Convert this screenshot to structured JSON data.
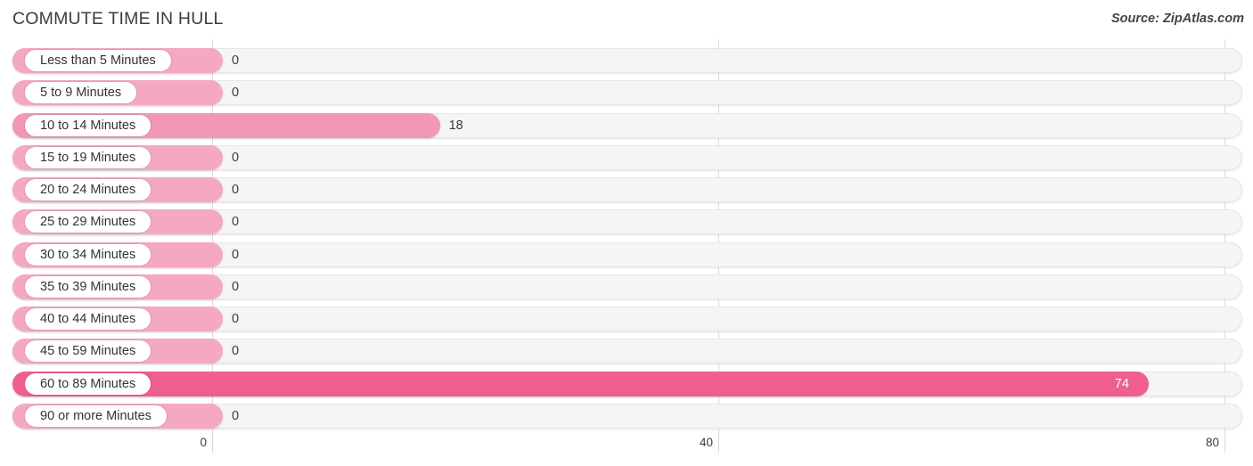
{
  "header": {
    "title": "COMMUTE TIME IN HULL",
    "source": "Source: ZipAtlas.com"
  },
  "chart_data": {
    "type": "bar",
    "orientation": "horizontal",
    "title": "COMMUTE TIME IN HULL",
    "xlabel": "",
    "ylabel": "",
    "xlim": [
      0,
      80
    ],
    "grid": true,
    "legend": "none",
    "xticks": [
      0,
      40,
      80
    ],
    "xtick_labels": [
      "0",
      "40",
      "80"
    ],
    "categories": [
      "Less than 5 Minutes",
      "5 to 9 Minutes",
      "10 to 14 Minutes",
      "15 to 19 Minutes",
      "20 to 24 Minutes",
      "25 to 29 Minutes",
      "30 to 34 Minutes",
      "35 to 39 Minutes",
      "40 to 44 Minutes",
      "45 to 59 Minutes",
      "60 to 89 Minutes",
      "90 or more Minutes"
    ],
    "values": [
      0,
      0,
      18,
      0,
      0,
      0,
      0,
      0,
      0,
      0,
      74,
      0
    ],
    "value_labels": [
      "0",
      "0",
      "18",
      "0",
      "0",
      "0",
      "0",
      "0",
      "0",
      "0",
      "74",
      "0"
    ]
  },
  "rows": [
    {
      "label": "Less than 5 Minutes",
      "value": 0,
      "value_label": "0",
      "color": "#f5a8c3",
      "label_inside": false
    },
    {
      "label": "5 to 9 Minutes",
      "value": 0,
      "value_label": "0",
      "color": "#f5a8c3",
      "label_inside": false
    },
    {
      "label": "10 to 14 Minutes",
      "value": 18,
      "value_label": "18",
      "color": "#f297b6",
      "label_inside": false
    },
    {
      "label": "15 to 19 Minutes",
      "value": 0,
      "value_label": "0",
      "color": "#f5a8c3",
      "label_inside": false
    },
    {
      "label": "20 to 24 Minutes",
      "value": 0,
      "value_label": "0",
      "color": "#f5a8c3",
      "label_inside": false
    },
    {
      "label": "25 to 29 Minutes",
      "value": 0,
      "value_label": "0",
      "color": "#f5a8c3",
      "label_inside": false
    },
    {
      "label": "30 to 34 Minutes",
      "value": 0,
      "value_label": "0",
      "color": "#f5a8c3",
      "label_inside": false
    },
    {
      "label": "35 to 39 Minutes",
      "value": 0,
      "value_label": "0",
      "color": "#f5a8c3",
      "label_inside": false
    },
    {
      "label": "40 to 44 Minutes",
      "value": 0,
      "value_label": "0",
      "color": "#f5a8c3",
      "label_inside": false
    },
    {
      "label": "45 to 59 Minutes",
      "value": 0,
      "value_label": "0",
      "color": "#f5a8c3",
      "label_inside": false
    },
    {
      "label": "60 to 89 Minutes",
      "value": 74,
      "value_label": "74",
      "color": "#ef5f8d",
      "label_inside": true
    },
    {
      "label": "90 or more Minutes",
      "value": 0,
      "value_label": "0",
      "color": "#f5a8c3",
      "label_inside": false
    }
  ],
  "axis": {
    "ticks": [
      {
        "label": "0",
        "value": 0
      },
      {
        "label": "40",
        "value": 40
      },
      {
        "label": "80",
        "value": 80
      }
    ]
  },
  "colors": {
    "bar_light": "#f5a8c3",
    "bar_mid": "#f297b6",
    "bar_strong": "#ef5f8d",
    "track": "#f5f5f5",
    "gridline": "#dcdcdc",
    "text": "#3a3a42"
  }
}
